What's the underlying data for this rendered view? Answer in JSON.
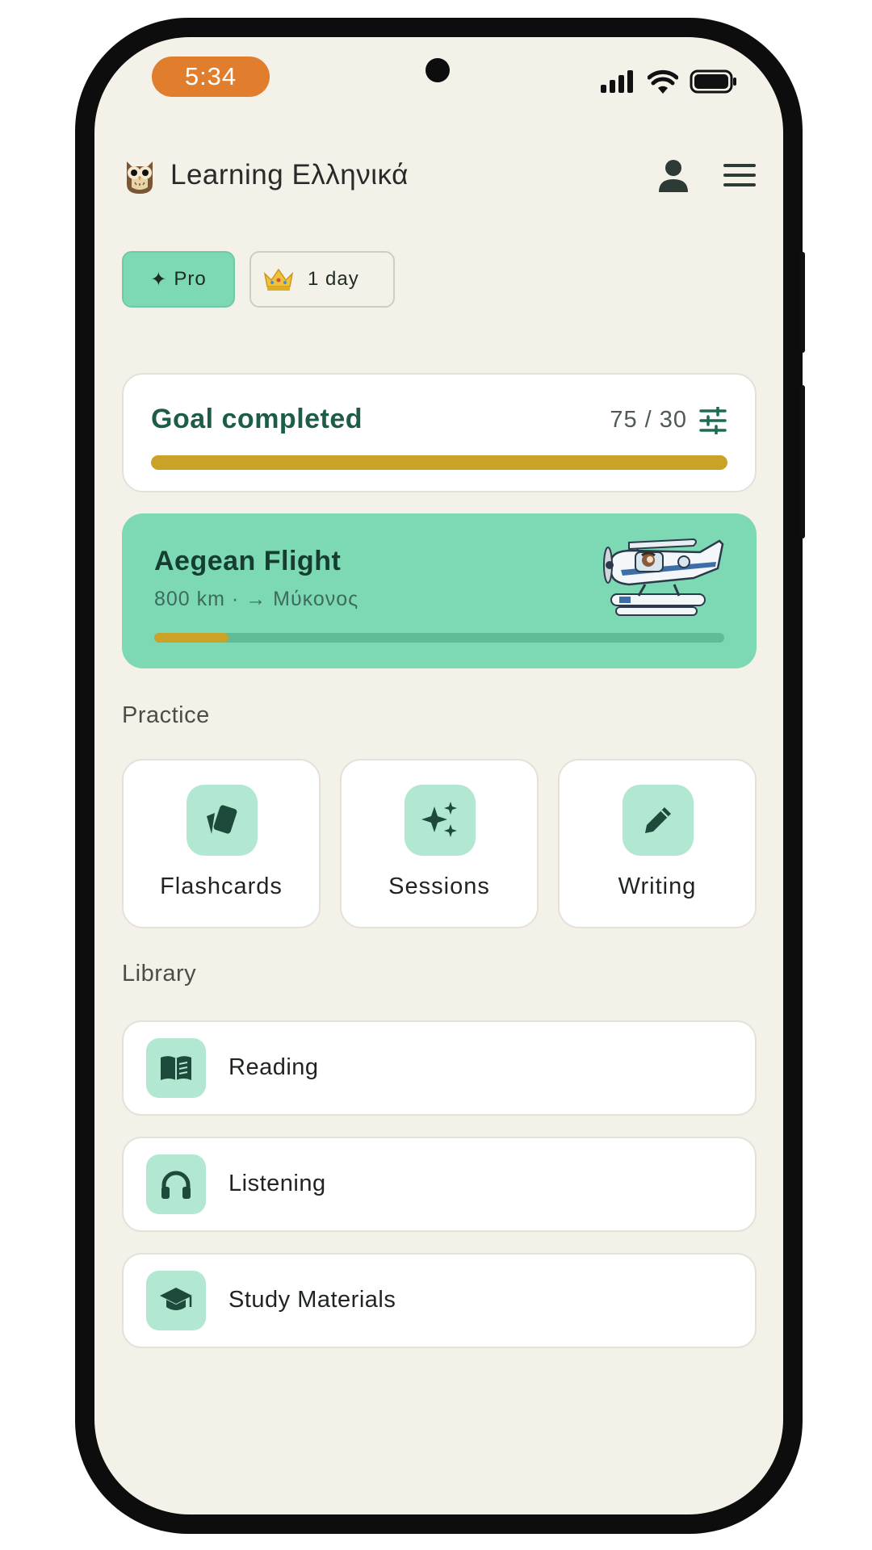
{
  "status_bar": {
    "time": "5:34"
  },
  "header": {
    "title": "Learning Ελληνικά",
    "logo_icon": "owl-icon",
    "profile_icon": "person-icon",
    "menu_icon": "menu-icon"
  },
  "chips": {
    "pro": {
      "glyph": "✦",
      "label": "Pro"
    },
    "streak": {
      "icon": "crown-icon",
      "label": "1 day"
    }
  },
  "goal": {
    "title": "Goal completed",
    "count": "75 / 30",
    "progress": 1.0,
    "icon": "tune-icon"
  },
  "flight": {
    "title": "Aegean Flight",
    "subtitle": "800 km · → Μύκονος",
    "progress": 0.13,
    "illustration": "seaplane-icon"
  },
  "practice": {
    "label": "Practice",
    "items": [
      {
        "label": "Flashcards",
        "icon": "cards-icon"
      },
      {
        "label": "Sessions",
        "icon": "sparkles-icon"
      },
      {
        "label": "Writing",
        "icon": "pencil-icon"
      }
    ]
  },
  "library": {
    "label": "Library",
    "items": [
      {
        "label": "Reading",
        "icon": "book-icon"
      },
      {
        "label": "Listening",
        "icon": "headphones-icon"
      },
      {
        "label": "Study Materials",
        "icon": "graduation-cap-icon"
      }
    ]
  },
  "colors": {
    "accent": "#7dd9b4",
    "accent_soft": "#b2e8d2",
    "progress": "#c9a227",
    "title_green": "#1d5c48",
    "time_pill": "#e07e2e",
    "background": "#f4f1e9"
  }
}
